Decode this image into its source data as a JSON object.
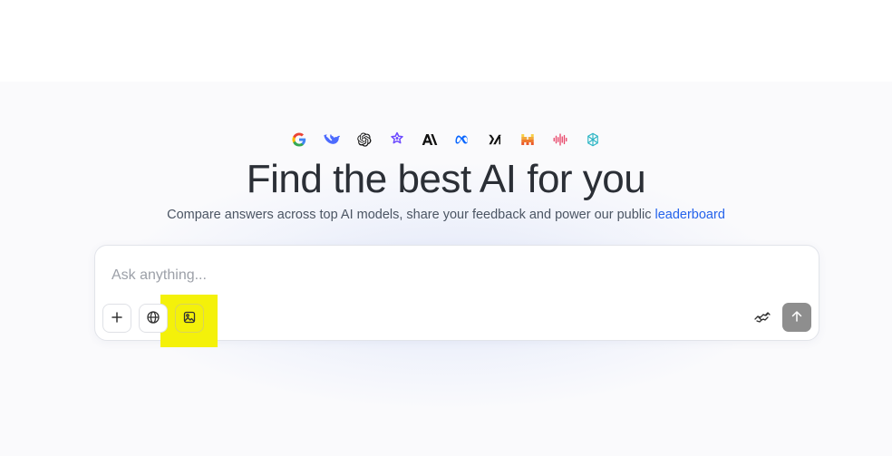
{
  "header": {
    "headline": "Find the best AI for you",
    "subline_text": "Compare answers across top AI models, share your feedback and power our public ",
    "subline_link": "leaderboard"
  },
  "logos": [
    {
      "icon": "google-logo-icon"
    },
    {
      "icon": "deepseek-logo-icon"
    },
    {
      "icon": "openai-logo-icon"
    },
    {
      "icon": "gemini-star-logo-icon"
    },
    {
      "icon": "anthropic-logo-icon"
    },
    {
      "icon": "meta-logo-icon"
    },
    {
      "icon": "xai-logo-icon"
    },
    {
      "icon": "mistral-logo-icon"
    },
    {
      "icon": "cohere-wave-logo-icon"
    },
    {
      "icon": "qwen-logo-icon"
    }
  ],
  "prompt": {
    "placeholder": "Ask anything...",
    "value": ""
  },
  "toolbar": {
    "add_icon": "plus-icon",
    "web_icon": "globe-icon",
    "image_icon": "image-icon",
    "handshake_icon": "handshake-icon",
    "send_icon": "arrow-up-icon"
  },
  "colors": {
    "accent_link": "#2563eb",
    "highlight": "#f4f10a",
    "send_button": "#8e8e8e",
    "headline": "#2b2f36"
  }
}
